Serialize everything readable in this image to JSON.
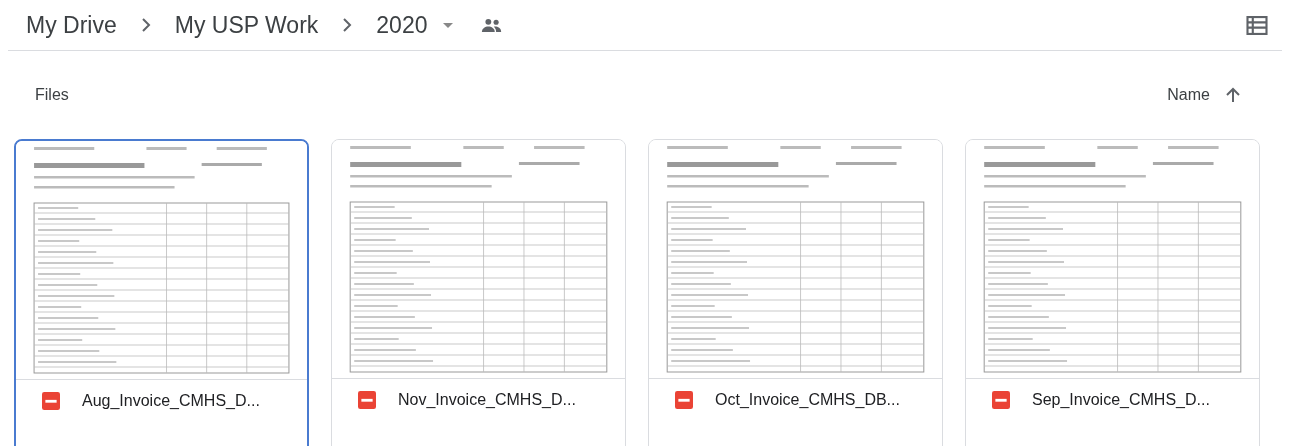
{
  "breadcrumb": [
    {
      "label": "My Drive"
    },
    {
      "label": "My USP Work"
    },
    {
      "label": "2020"
    }
  ],
  "section": {
    "title": "Files",
    "sort": {
      "label": "Name"
    }
  },
  "files": [
    {
      "name": "Aug_Invoice_CMHS_D...",
      "selected": true,
      "kind": "picture"
    },
    {
      "name": "Nov_Invoice_CMHS_D...",
      "selected": false,
      "kind": "picture"
    },
    {
      "name": "Oct_Invoice_CMHS_DB...",
      "selected": false,
      "kind": "picture"
    },
    {
      "name": "Sep_Invoice_CMHS_D...",
      "selected": false,
      "kind": "picture"
    }
  ]
}
